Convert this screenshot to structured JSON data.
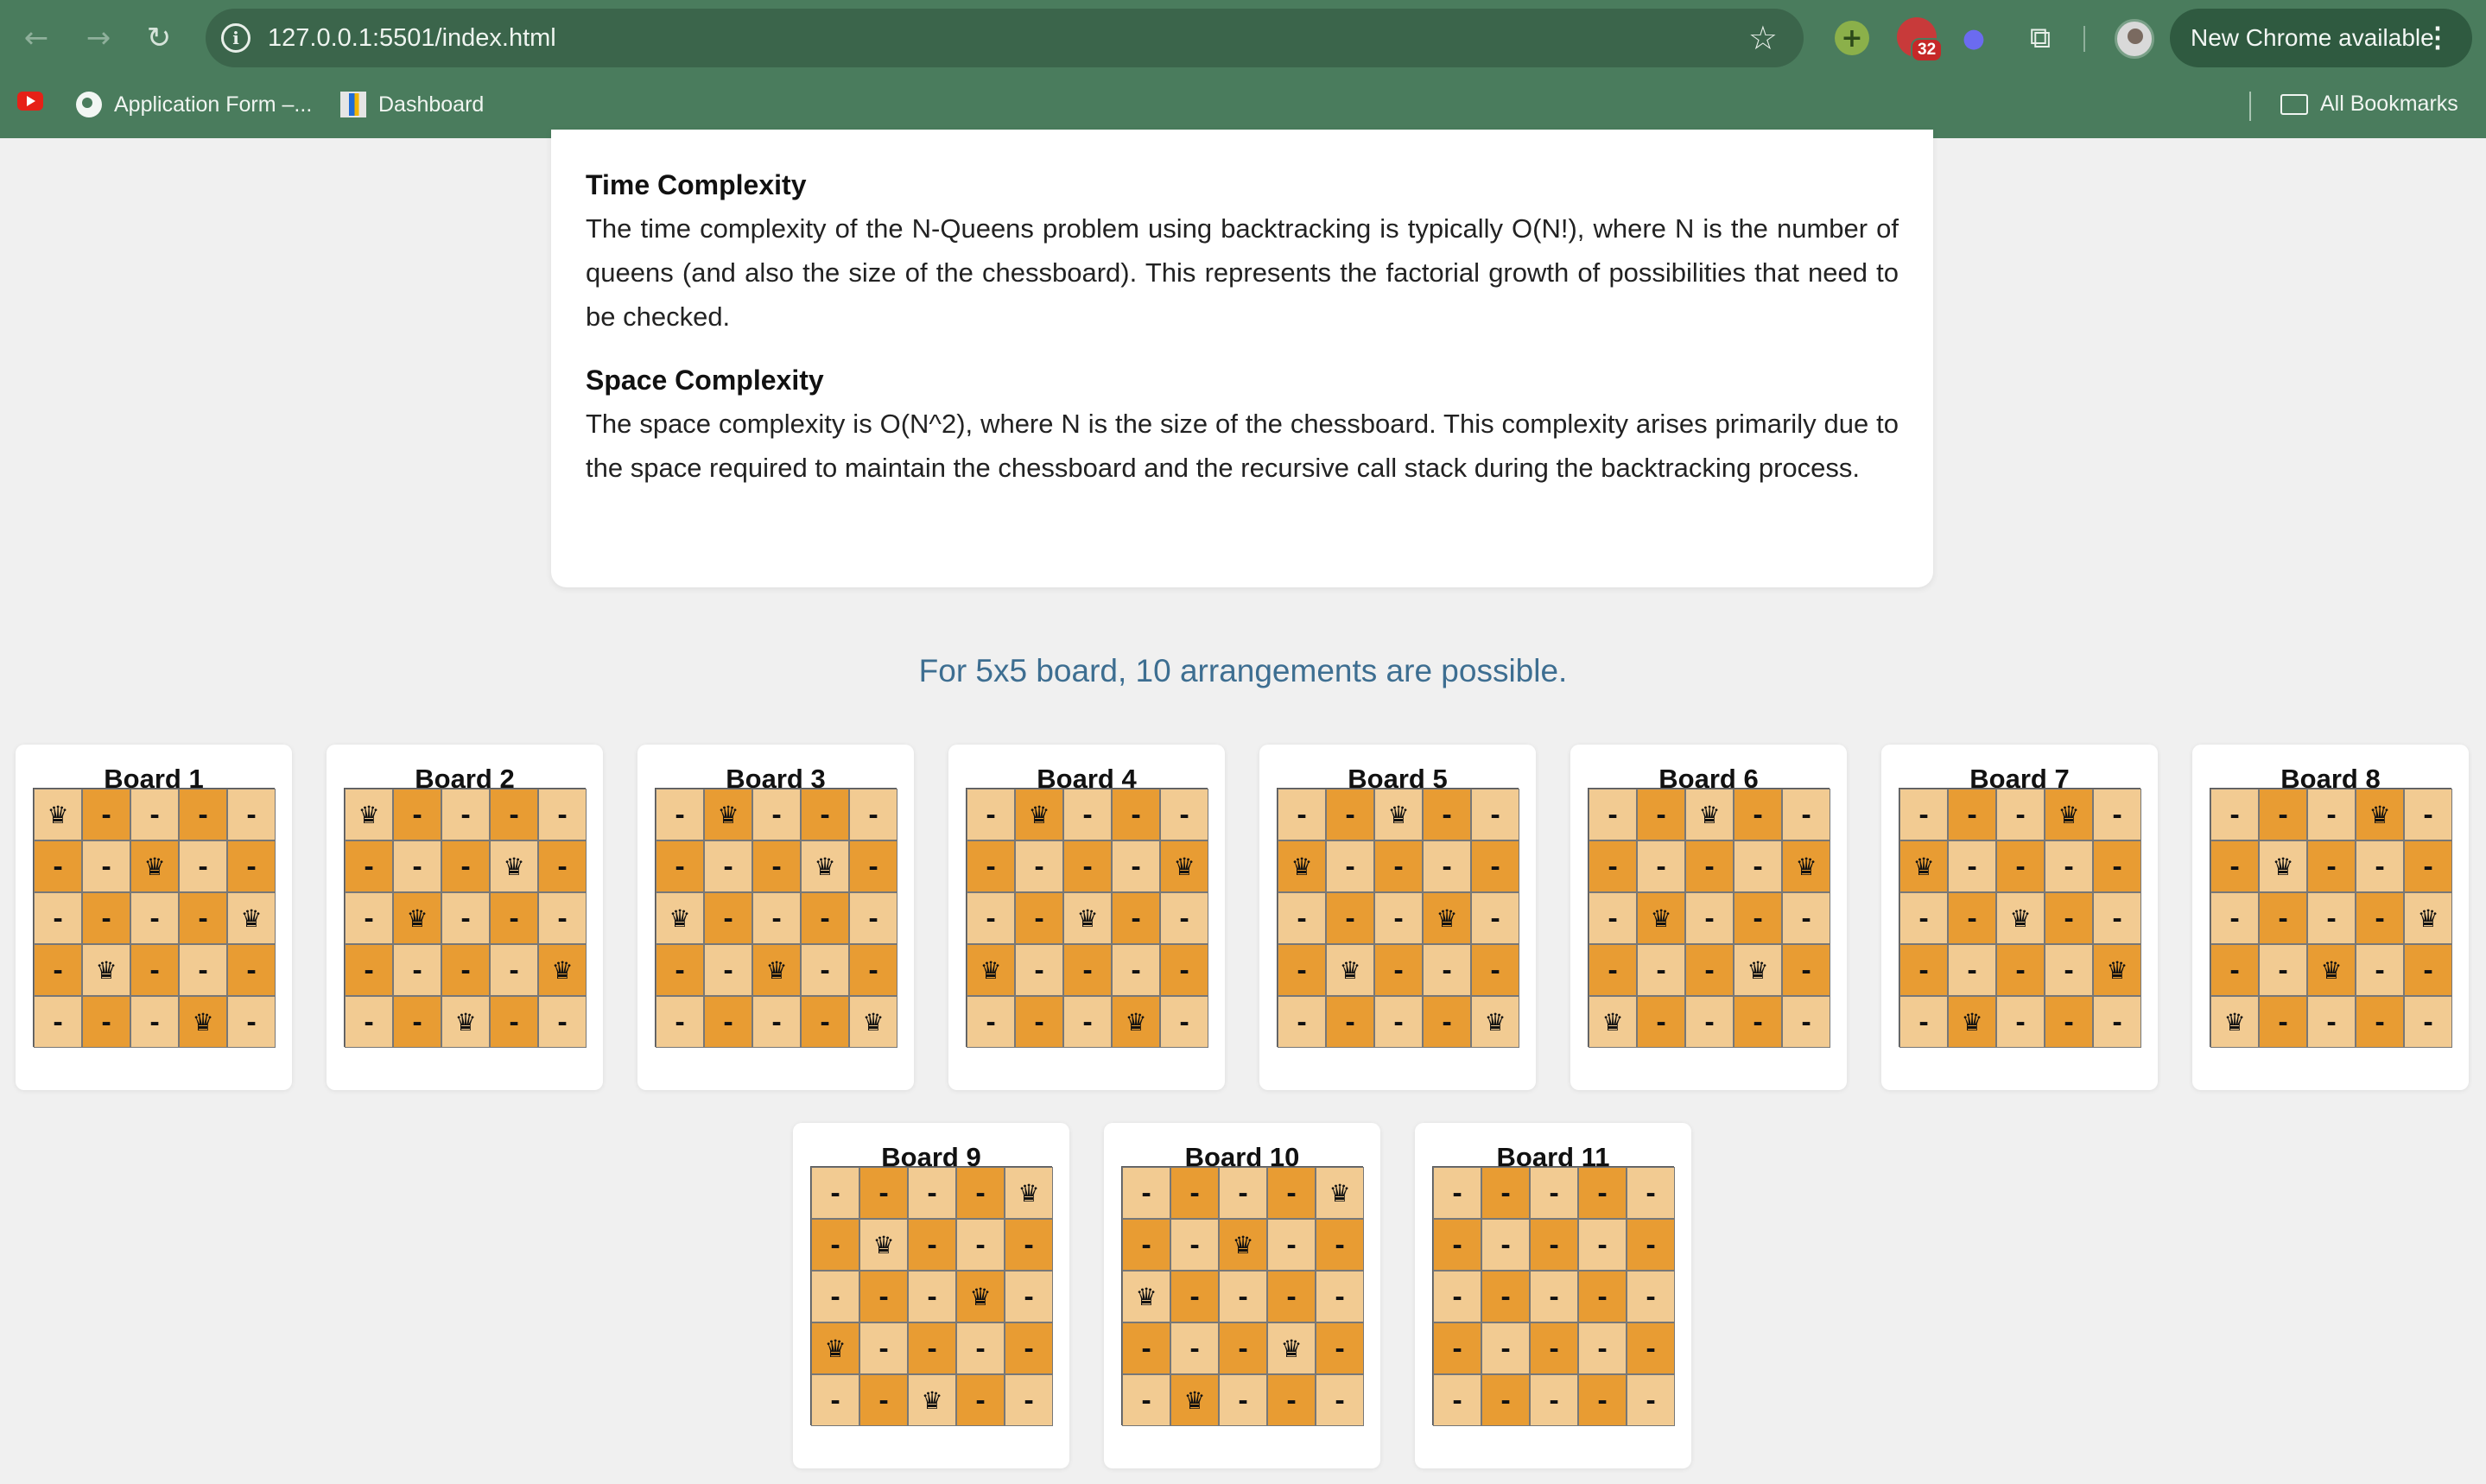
{
  "browser": {
    "url": "127.0.0.1:5501/index.html",
    "update_label": "New Chrome available",
    "extension_badge": "32",
    "bookmarks": [
      {
        "label": "Application Form –..."
      },
      {
        "label": "Dashboard"
      }
    ],
    "all_bookmarks_label": "All Bookmarks"
  },
  "content": {
    "time_title": "Time Complexity",
    "time_text": "The time complexity of the N-Queens problem using backtracking is typically O(N!), where N is the number of queens (and also the size of the chessboard). This represents the factorial growth of possibilities that need to be checked.",
    "space_title": "Space Complexity",
    "space_text": "The space complexity is O(N^2), where N is the size of the chessboard. This complexity arises primarily due to the space required to maintain the chessboard and the recursive call stack during the backtracking process.",
    "summary": "For 5x5 board, 10 arrangements are possible."
  },
  "symbols": {
    "queen": "♛",
    "empty": "-"
  },
  "board_colors": {
    "light": "#f2cb92",
    "dark": "#e89c33"
  },
  "boards": [
    {
      "title": "Board 1",
      "queens": [
        0,
        2,
        4,
        1,
        3
      ]
    },
    {
      "title": "Board 2",
      "queens": [
        0,
        3,
        1,
        4,
        2
      ]
    },
    {
      "title": "Board 3",
      "queens": [
        1,
        3,
        0,
        2,
        4
      ]
    },
    {
      "title": "Board 4",
      "queens": [
        1,
        4,
        2,
        0,
        3
      ]
    },
    {
      "title": "Board 5",
      "queens": [
        2,
        0,
        3,
        1,
        4
      ]
    },
    {
      "title": "Board 6",
      "queens": [
        2,
        4,
        1,
        3,
        0
      ]
    },
    {
      "title": "Board 7",
      "queens": [
        3,
        0,
        2,
        4,
        1
      ]
    },
    {
      "title": "Board 8",
      "queens": [
        3,
        1,
        4,
        2,
        0
      ]
    },
    {
      "title": "Board 9",
      "queens": [
        4,
        1,
        3,
        0,
        2
      ]
    },
    {
      "title": "Board 10",
      "queens": [
        4,
        2,
        0,
        3,
        1
      ]
    },
    {
      "title": "Board 11",
      "queens": [
        -1,
        -1,
        -1,
        -1,
        -1
      ]
    }
  ]
}
